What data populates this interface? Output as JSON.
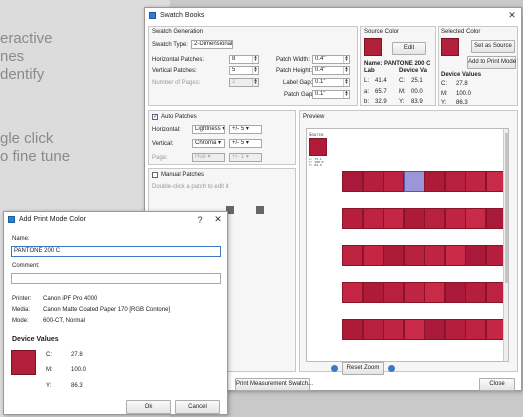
{
  "background": {
    "lines": [
      "eractive",
      "nes",
      "dentify",
      "gle click",
      "o fine tune"
    ]
  },
  "swatch_window": {
    "title": "Swatch Books",
    "generation": {
      "section_title": "Swatch Generation",
      "swatch_type_label": "Swatch Type:",
      "swatch_type_value": "2-Dimensional",
      "h_patches_label": "Horizontal Patches:",
      "h_patches_value": "8",
      "v_patches_label": "Vertical Patches:",
      "v_patches_value": "5",
      "pages_label": "Number of Pages:",
      "pages_value": "2",
      "patch_width_label": "Patch Width:",
      "patch_width_value": "0.4\"",
      "patch_height_label": "Patch Height:",
      "patch_height_value": "0.4\"",
      "label_gap_label": "Label Gap:",
      "label_gap_value": "0.1\"",
      "patch_gap_label": "Patch Gap:",
      "patch_gap_value": "0.1\""
    },
    "source": {
      "section_title": "Source Color",
      "edit_label": "Edit",
      "name_line": "Name: PANTONE 200 C",
      "lab_title": "Lab",
      "device_title": "Device Va",
      "l_label": "L:",
      "l_value": "41.4",
      "a_label": "a:",
      "a_value": "65.7",
      "b_label": "b:",
      "b_value": "32.9",
      "c_label": "C:",
      "c_value": "25.1",
      "m_label": "M:",
      "m_value": "00.0",
      "y_label": "Y:",
      "y_value": "83.9"
    },
    "selected": {
      "section_title": "Selected Color",
      "set_source_label": "Set as Source",
      "add_print_label": "Add to Print Mode",
      "device_title": "Device Values",
      "c_label": "C:",
      "c_value": "27.8",
      "m_label": "M:",
      "m_value": "100.0",
      "y_label": "Y:",
      "y_value": "86.3"
    },
    "auto": {
      "label": "Auto Patches",
      "horizontal_label": "Horizontal:",
      "horizontal_value": "Lightness",
      "horizontal_step": "+/- 5",
      "vertical_label": "Vertical:",
      "vertical_value": "Chroma",
      "vertical_step": "+/- 5",
      "page_label": "Page:",
      "page_value": "Hue",
      "page_step": "+/- 1"
    },
    "manual": {
      "label": "Manual Patches",
      "hint": "Double-click a patch to edit it"
    },
    "preview": {
      "title": "Preview",
      "source_label": "Source",
      "source_values": "L: 75.1\nC: 100.0\nY: 84.0",
      "reset_zoom_label": "Reset Zoom"
    },
    "footer": {
      "print_label": "Print Measurement Swatch...",
      "close_label": "Close"
    },
    "colors": {
      "swatch": "#b21f3a",
      "selected_patch": "#9b96d8"
    }
  },
  "dialog": {
    "title": "Add Print Mode Color",
    "help_label": "?",
    "close_label": "✕",
    "name_label": "Name:",
    "name_value": "PANTONE 200 C",
    "comment_label": "Comment:",
    "comment_value": "",
    "printer_label": "Printer:",
    "printer_value": "Canon iPF Pro 4000",
    "media_label": "Media:",
    "media_value": "Canon Matte Coated Paper 170 [RGB Contone]",
    "mode_label": "Mode:",
    "mode_value": "600-CT, Normal",
    "device_title": "Device Values",
    "c_label": "C:",
    "c_value": "27.8",
    "m_label": "M:",
    "m_value": "100.0",
    "y_label": "Y:",
    "y_value": "86.3",
    "ok_label": "Ok",
    "cancel_label": "Cancel"
  }
}
